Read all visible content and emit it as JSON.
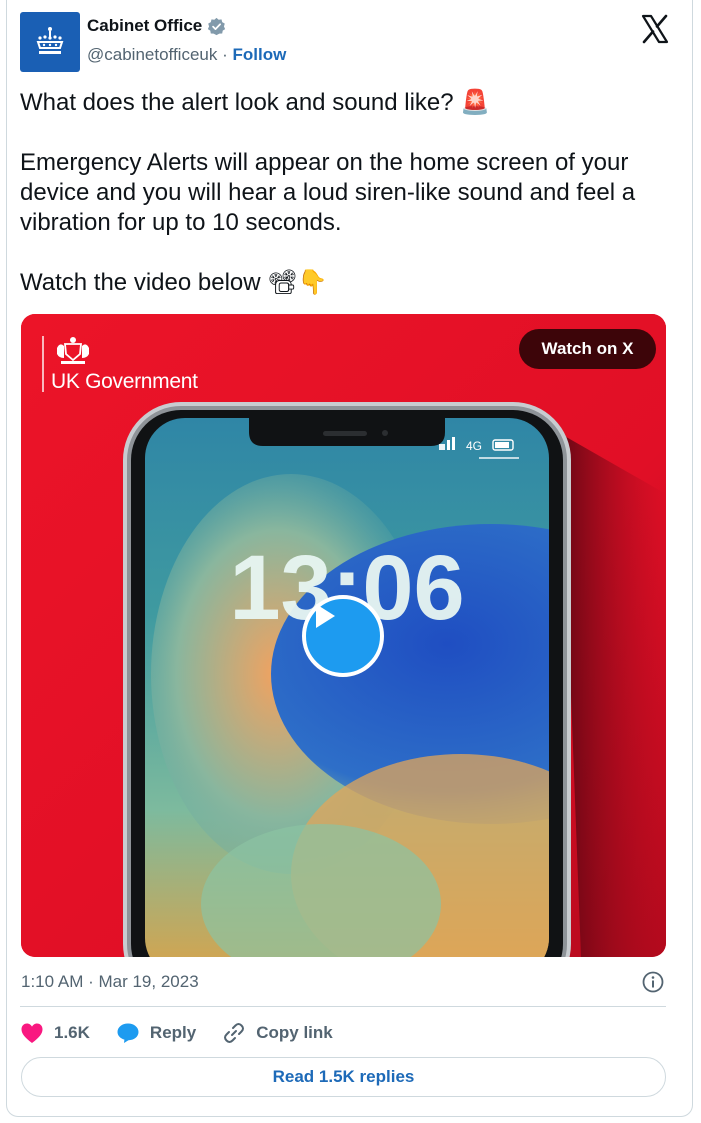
{
  "author": {
    "name": "Cabinet Office",
    "handle": "@cabinetofficeuk",
    "separator": "·",
    "follow_label": "Follow"
  },
  "tweet": {
    "line1": "What does the alert look and sound like? 🚨",
    "line2": "Emergency Alerts will appear on the home screen of your device and you will hear a loud siren-like sound and feel a vibration for up to 10 seconds.",
    "line3": "Watch the video below 📽👇"
  },
  "media": {
    "watch_label": "Watch on X",
    "org_label": "UK Government",
    "phone_time": "13:06",
    "phone_network": "4G"
  },
  "meta": {
    "timestamp": "1:10 AM · Mar 19, 2023"
  },
  "actions": {
    "likes": "1.6K",
    "reply_label": "Reply",
    "copy_label": "Copy link",
    "read_replies_label": "Read 1.5K replies"
  },
  "colors": {
    "accent": "#1d6ab8",
    "play": "#1d9bf0",
    "media_bg": "#e3102a",
    "like": "#f91880",
    "avatar_bg": "#1a5fb4"
  }
}
